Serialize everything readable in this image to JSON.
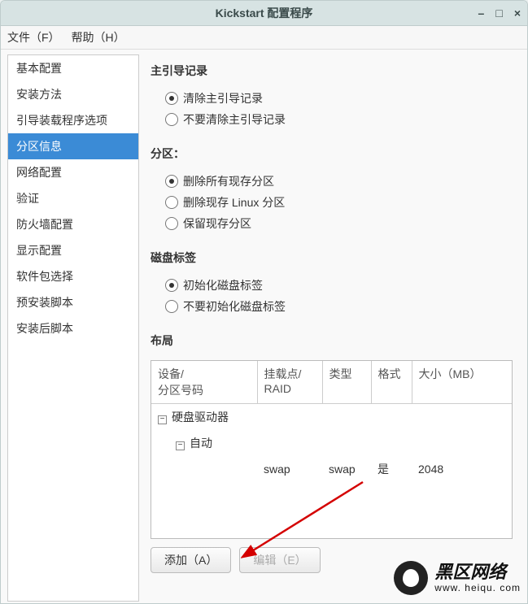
{
  "title": "Kickstart 配置程序",
  "menubar": {
    "file": "文件（F）",
    "help": "帮助（H）"
  },
  "sidebar": {
    "items": [
      {
        "label": "基本配置"
      },
      {
        "label": "安装方法"
      },
      {
        "label": "引导装载程序选项"
      },
      {
        "label": "分区信息"
      },
      {
        "label": "网络配置"
      },
      {
        "label": "验证"
      },
      {
        "label": "防火墙配置"
      },
      {
        "label": "显示配置"
      },
      {
        "label": "软件包选择"
      },
      {
        "label": "预安装脚本"
      },
      {
        "label": "安装后脚本"
      }
    ],
    "selected_index": 3
  },
  "sections": {
    "mbr": {
      "title": "主引导记录",
      "options": [
        "清除主引导记录",
        "不要清除主引导记录"
      ],
      "selected": 0
    },
    "partition": {
      "title": "分区：",
      "options": [
        "删除所有现存分区",
        "删除现存 Linux 分区",
        "保留现存分区"
      ],
      "selected": 0
    },
    "disklabel": {
      "title": "磁盘标签",
      "options": [
        "初始化磁盘标签",
        "不要初始化磁盘标签"
      ],
      "selected": 0
    },
    "layout": {
      "title": "布局"
    }
  },
  "table": {
    "headers": {
      "device": "设备/\n分区号码",
      "mount": "挂载点/\nRAID",
      "type": "类型",
      "format": "格式",
      "size": "大小（MB）"
    },
    "tree": {
      "root": "硬盘驱动器",
      "child": "自动",
      "row": {
        "mount": "swap",
        "type": "swap",
        "format": "是",
        "size": "2048"
      }
    }
  },
  "buttons": {
    "add": "添加（A）",
    "edit": "编辑（E）"
  },
  "watermark": {
    "line1": "黑区网络",
    "line2": "www. heiqu. com"
  }
}
